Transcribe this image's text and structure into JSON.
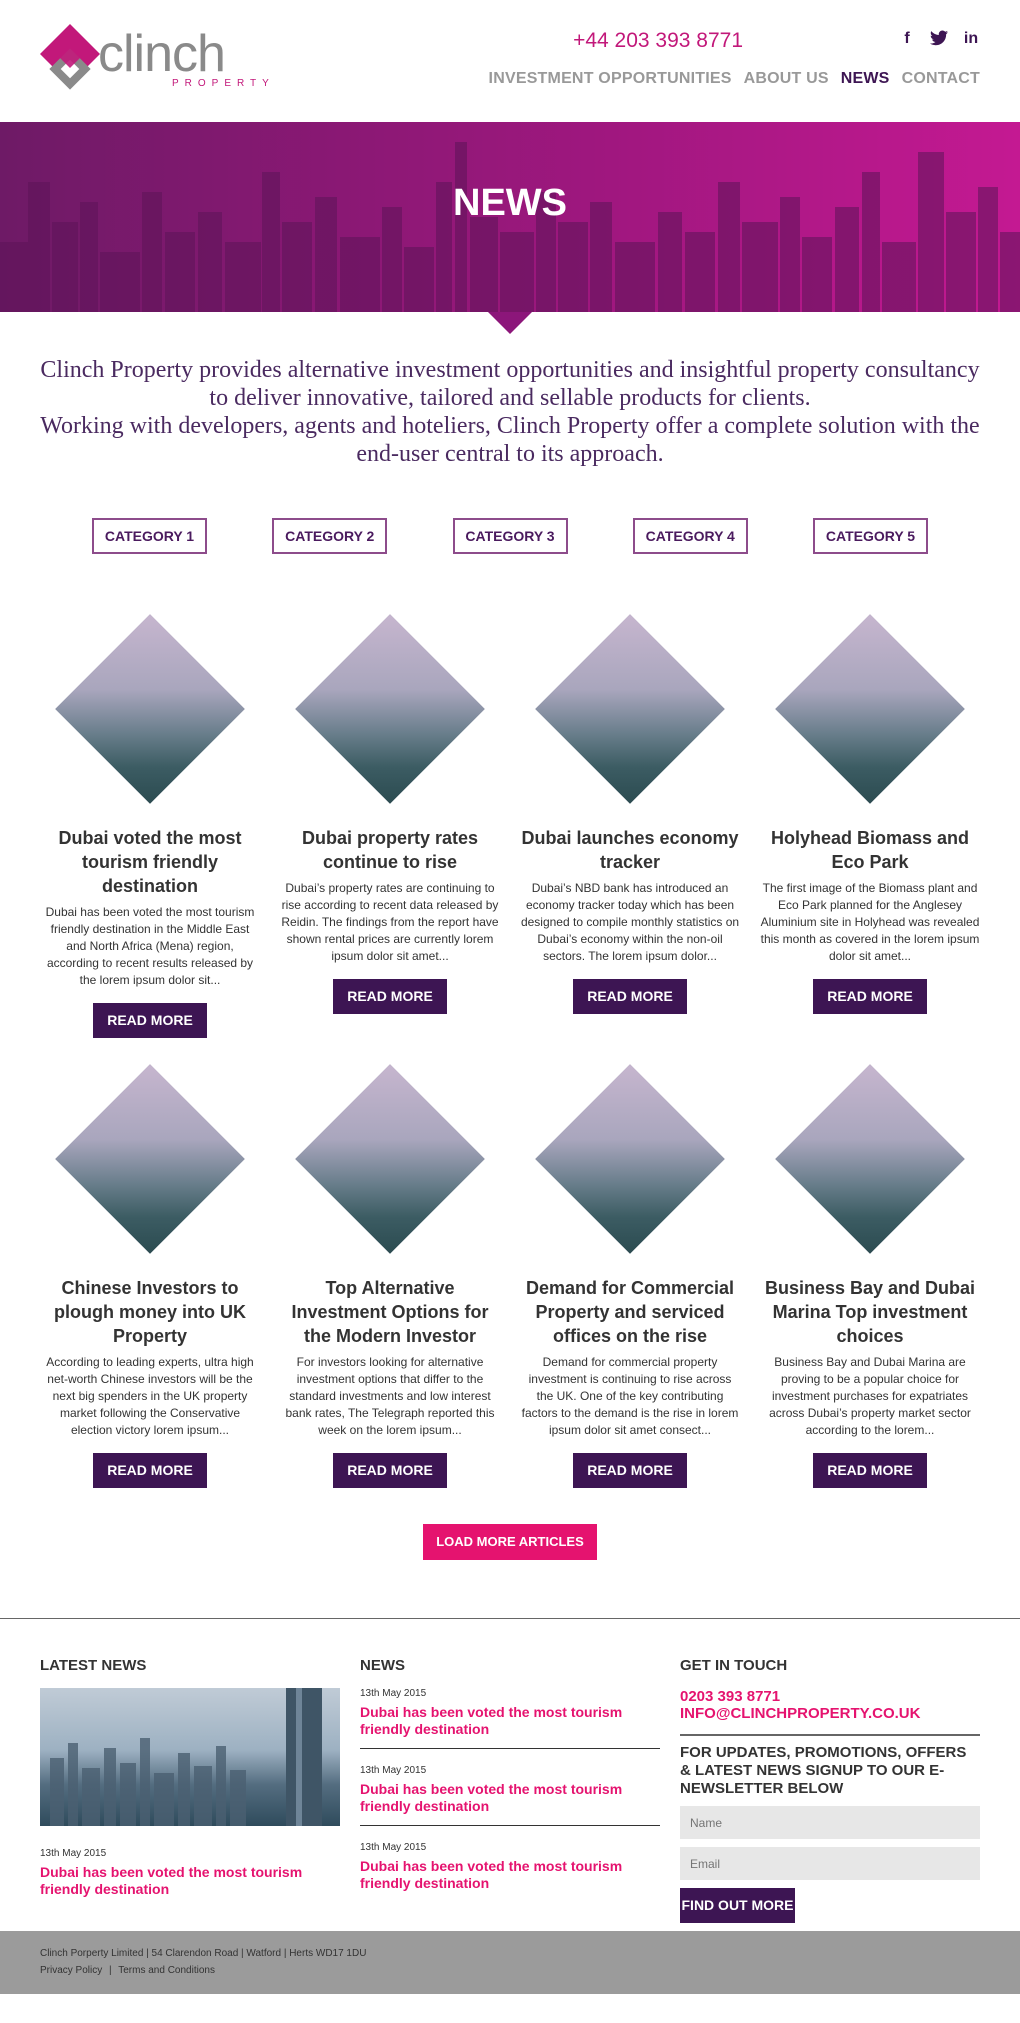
{
  "header": {
    "logo_word": "clinch",
    "logo_sub": "PROPERTY",
    "phone": "+44 203 393 8771",
    "social": [
      {
        "name": "facebook",
        "glyph": "f"
      },
      {
        "name": "twitter",
        "glyph": "t"
      },
      {
        "name": "linkedin",
        "glyph": "in"
      }
    ],
    "nav": [
      "INVESTMENT OPPORTUNITIES",
      "ABOUT US",
      "NEWS",
      "CONTACT"
    ],
    "active_nav": "NEWS"
  },
  "hero": {
    "title": "NEWS"
  },
  "intro": {
    "line1": "Clinch Property provides alternative investment opportunities and insightful property consultancy to deliver innovative, tailored and sellable products for clients.",
    "line2": "Working with developers, agents and hoteliers, Clinch Property offer a complete solution with the end-user central to its approach."
  },
  "categories": [
    "CATEGORY 1",
    "CATEGORY 2",
    "CATEGORY 3",
    "CATEGORY 4",
    "CATEGORY 5"
  ],
  "articles": [
    {
      "title": "Dubai voted the most tourism friendly destination",
      "excerpt": "Dubai has been voted the most tourism friendly destination in the Middle East and North Africa (Mena) region, according to recent results released by the lorem ipsum dolor sit...",
      "button": "READ MORE"
    },
    {
      "title": "Dubai property rates continue to rise",
      "excerpt": "Dubai’s property rates are continuing to rise according to recent data released by Reidin. The findings from the report have shown rental prices are currently lorem ipsum dolor sit amet...",
      "button": "READ MORE"
    },
    {
      "title": "Dubai launches economy tracker",
      "excerpt": "Dubai’s NBD bank has introduced an economy tracker today which has been designed to compile monthly statistics on Dubai’s economy within the non-oil sectors. The lorem ipsum dolor...",
      "button": "READ MORE"
    },
    {
      "title": "Holyhead Biomass and Eco Park",
      "excerpt": "The first image of the Biomass plant and Eco Park planned for the Anglesey Aluminium site in Holyhead was revealed this month as covered in the lorem ipsum dolor sit amet...",
      "button": "READ MORE"
    },
    {
      "title": "Chinese Investors to plough money into UK Property",
      "excerpt": "According to leading experts, ultra high net-worth Chinese investors will be the next big spenders in the UK property market following the Conservative election victory lorem ipsum...",
      "button": "READ MORE"
    },
    {
      "title": "Top Alternative Investment Options for the Modern Investor",
      "excerpt": "For investors looking for alternative investment options that differ to the standard investments and low interest bank rates, The Telegraph reported this week on the lorem ipsum...",
      "button": "READ MORE"
    },
    {
      "title": "Demand for Commercial Property and serviced offices on the rise",
      "excerpt": "Demand for commercial property investment is continuing to rise across the UK. One of the key contributing factors to the demand is the rise in lorem ipsum dolor sit amet consect...",
      "button": "READ MORE"
    },
    {
      "title": "Business Bay and Dubai Marina Top investment choices",
      "excerpt": "Business Bay and Dubai Marina are proving to be a popular choice for investment purchases for expatriates across Dubai’s property market sector according to the lorem...",
      "button": "READ MORE"
    }
  ],
  "load_more": "LOAD MORE ARTICLES",
  "footer": {
    "latest_news": {
      "heading": "LATEST NEWS",
      "date": "13th May 2015",
      "link": "Dubai has been voted the most tourism friendly destination"
    },
    "news": {
      "heading": "NEWS",
      "items": [
        {
          "date": "13th May 2015",
          "link": "Dubai has been voted the most tourism friendly destination"
        },
        {
          "date": "13th May 2015",
          "link": "Dubai has been voted the most tourism friendly destination"
        },
        {
          "date": "13th May 2015",
          "link": "Dubai has been voted the most tourism friendly destination"
        }
      ]
    },
    "contact": {
      "heading": "GET IN TOUCH",
      "phone": "0203 393 8771",
      "email": "INFO@CLINCHPROPERTY.CO.UK",
      "signup": "FOR UPDATES, PROMOTIONS, OFFERS & LATEST NEWS SIGNUP TO OUR E-NEWSLETTER BELOW",
      "name_placeholder": "Name",
      "email_placeholder": "Email",
      "button": "FIND OUT MORE"
    },
    "address": "Clinch Porperty Limited | 54 Clarendon Road | Watford | Herts WD17 1DU",
    "privacy": "Privacy Policy",
    "terms": "Terms and Conditions",
    "separator": "|"
  },
  "colors": {
    "brand_purple": "#3d1553",
    "brand_magenta": "#c2187a",
    "accent_pink": "#e5136f"
  }
}
